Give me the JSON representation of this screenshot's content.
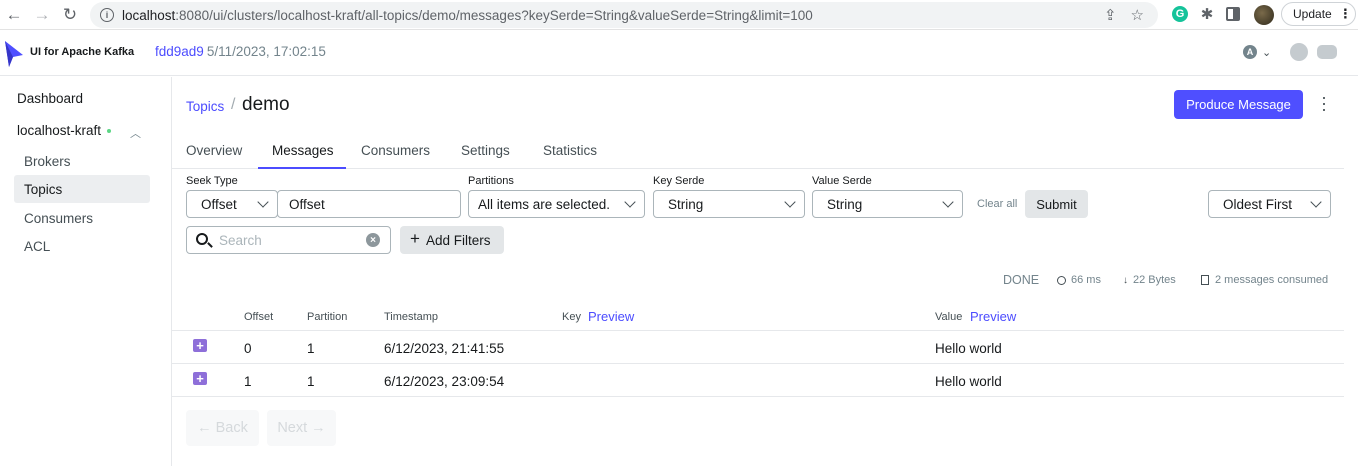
{
  "browser": {
    "url_host": "localhost",
    "url_rest": ":8080/ui/clusters/localhost-kraft/all-topics/demo/messages?keySerde=String&valueSerde=String&limit=100",
    "update_label": "Update"
  },
  "app": {
    "brand": "UI for Apache Kafka",
    "version": "fdd9ad9",
    "version_date": "5/11/2023, 17:02:15",
    "lang": "A",
    "accent": "#4f4fff"
  },
  "sidebar": {
    "dashboard": "Dashboard",
    "cluster": "localhost-kraft",
    "items": [
      "Brokers",
      "Topics",
      "Consumers",
      "ACL"
    ],
    "active": "Topics"
  },
  "breadcrumb": {
    "parent": "Topics",
    "separator": "/",
    "title": "demo"
  },
  "produce_button": "Produce Message",
  "tabs": [
    "Overview",
    "Messages",
    "Consumers",
    "Settings",
    "Statistics"
  ],
  "active_tab": "Messages",
  "filters": {
    "seek_type_label": "Seek Type",
    "seek_type_value": "Offset",
    "offset_value": "Offset",
    "partitions_label": "Partitions",
    "partitions_value": "All items are selected.",
    "key_serde_label": "Key Serde",
    "key_serde_value": "String",
    "value_serde_label": "Value Serde",
    "value_serde_value": "String",
    "clear_all": "Clear all",
    "submit": "Submit",
    "sort_value": "Oldest First",
    "search_placeholder": "Search",
    "add_filters": "Add Filters"
  },
  "stats": {
    "status": "DONE",
    "elapsed": "66 ms",
    "bytes": "22 Bytes",
    "consumed": "2 messages consumed"
  },
  "table": {
    "headers": {
      "offset": "Offset",
      "partition": "Partition",
      "timestamp": "Timestamp",
      "key": "Key",
      "value": "Value",
      "preview": "Preview"
    },
    "rows": [
      {
        "offset": "0",
        "partition": "1",
        "timestamp": "6/12/2023, 21:41:55",
        "key": "",
        "value": "Hello world"
      },
      {
        "offset": "1",
        "partition": "1",
        "timestamp": "6/12/2023, 23:09:54",
        "key": "",
        "value": "Hello world"
      }
    ]
  },
  "pager": {
    "back": "← Back",
    "next": "Next →"
  }
}
